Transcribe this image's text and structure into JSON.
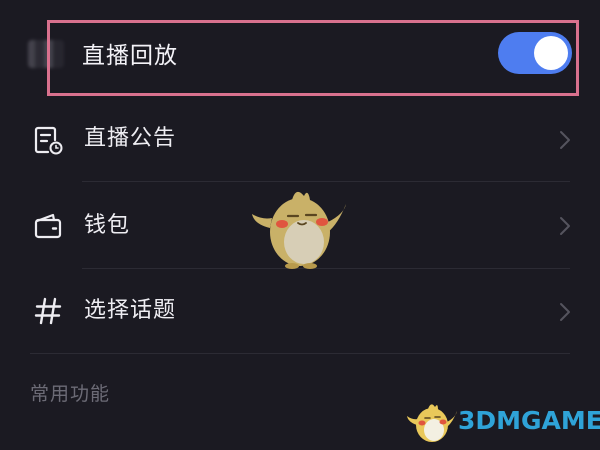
{
  "replay": {
    "label": "直播回放",
    "enabled": true,
    "toggle_color": "#4e7df0",
    "highlight_color": "#d9718e"
  },
  "menu": {
    "items": [
      {
        "label": "直播公告",
        "icon": "notice-document-icon"
      },
      {
        "label": "钱包",
        "icon": "wallet-icon"
      },
      {
        "label": "选择话题",
        "icon": "hashtag-icon"
      }
    ]
  },
  "section": {
    "title": "常用功能"
  },
  "watermark": {
    "text": "3DMGAME",
    "color": "#2fa3d8"
  }
}
